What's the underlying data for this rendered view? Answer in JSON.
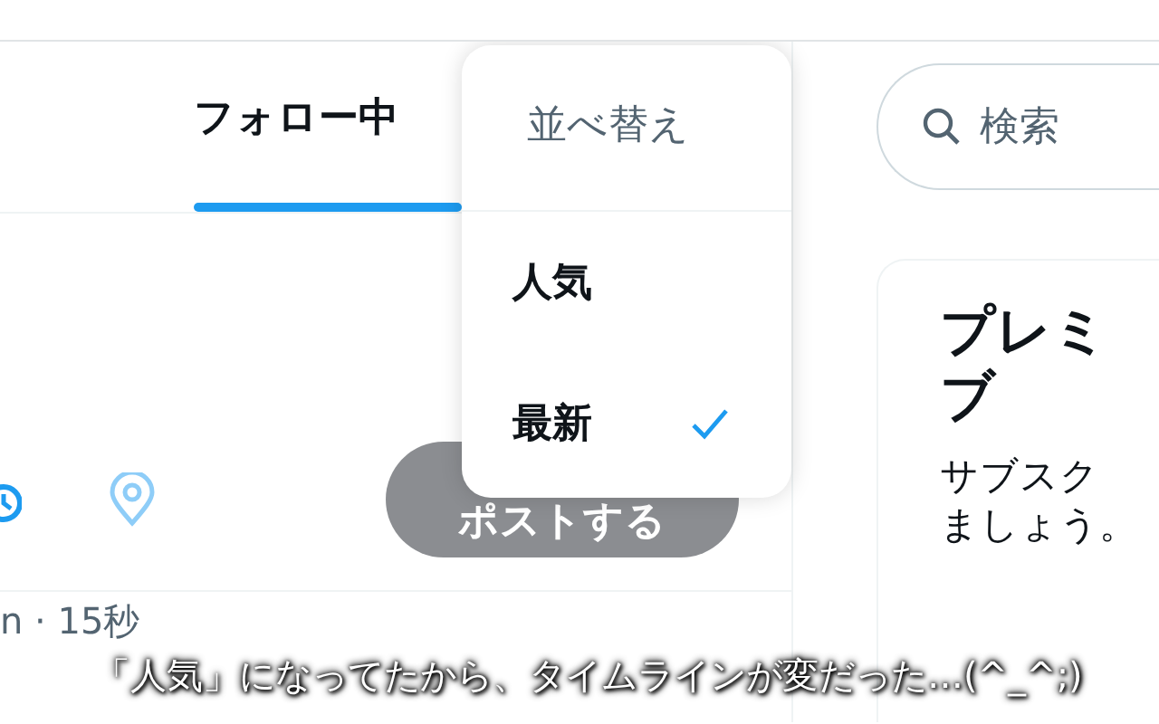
{
  "tabs": [
    {
      "label": "フォロー中",
      "selected": true
    }
  ],
  "composer": {
    "post_button": "ポストする",
    "post_enabled": false
  },
  "post_meta": "n · 15秒",
  "sort_menu": {
    "title": "並べ替え",
    "options": [
      {
        "label": "人気",
        "selected": false
      },
      {
        "label": "最新",
        "selected": true
      }
    ]
  },
  "search": {
    "placeholder": "検索"
  },
  "premium_card": {
    "title_lines": [
      "プレミ",
      "ブ"
    ],
    "body_lines": [
      "サブスク",
      "ましょう。"
    ]
  },
  "caption": "「人気」になってたから、タイムラインが変だった…(^_^;)"
}
